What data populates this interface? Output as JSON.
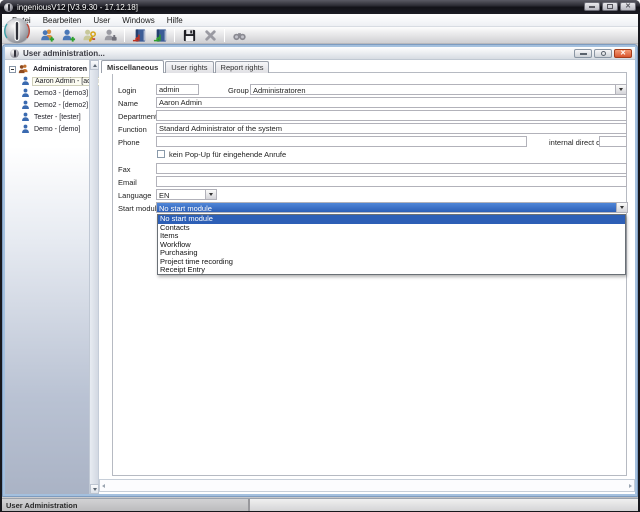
{
  "window": {
    "title": "ingeniousV12 [V3.9.30 - 17.12.18]"
  },
  "menubar": {
    "items": [
      "Datei",
      "Bearbeiten",
      "User",
      "Windows",
      "Hilfe"
    ]
  },
  "toolbar": {
    "icons": [
      "add-user-group",
      "add-user",
      "user-permissions",
      "deactivate-user",
      "import-rights",
      "export-rights",
      "save",
      "delete",
      "search"
    ]
  },
  "child_window": {
    "title": "User administration..."
  },
  "tree": {
    "root": "Administratoren",
    "items": [
      {
        "label": "Aaron Admin - [admin]",
        "selected": true
      },
      {
        "label": "Demo3 - [demo3]",
        "selected": false
      },
      {
        "label": "Demo2 - [demo2]",
        "selected": false
      },
      {
        "label": "Tester - [tester]",
        "selected": false
      },
      {
        "label": "Demo - [demo]",
        "selected": false
      }
    ]
  },
  "tabs": {
    "items": [
      "Miscellaneous",
      "User rights",
      "Report rights"
    ],
    "active": "Miscellaneous"
  },
  "form": {
    "login": {
      "label": "Login",
      "value": "admin"
    },
    "group": {
      "label": "Group",
      "value": "Administratoren"
    },
    "name": {
      "label": "Name",
      "value": "Aaron Admin"
    },
    "department": {
      "label": "Department",
      "value": ""
    },
    "function": {
      "label": "Function",
      "value": "Standard Administrator of the system"
    },
    "phone": {
      "label": "Phone",
      "value": "",
      "internal_label": "internal direct dail",
      "internal_value": ""
    },
    "popup_checkbox": {
      "label": "kein Pop-Up für eingehende Anrufe",
      "checked": false
    },
    "fax": {
      "label": "Fax",
      "value": ""
    },
    "email": {
      "label": "Email",
      "value": ""
    },
    "language": {
      "label": "Language",
      "value": "EN"
    },
    "start_module": {
      "label": "Start module",
      "value": "No start module",
      "selected_index": 0,
      "options": [
        "No start module",
        "Contacts",
        "Items",
        "Workflow",
        "Purchasing",
        "Project time recording",
        "Receipt Entry"
      ]
    }
  },
  "statusbar": {
    "text": "User Administration"
  },
  "colors": {
    "selection_blue": "#2d5fb6",
    "child_border": "#a4c0de",
    "close_red": "#d9552f"
  }
}
